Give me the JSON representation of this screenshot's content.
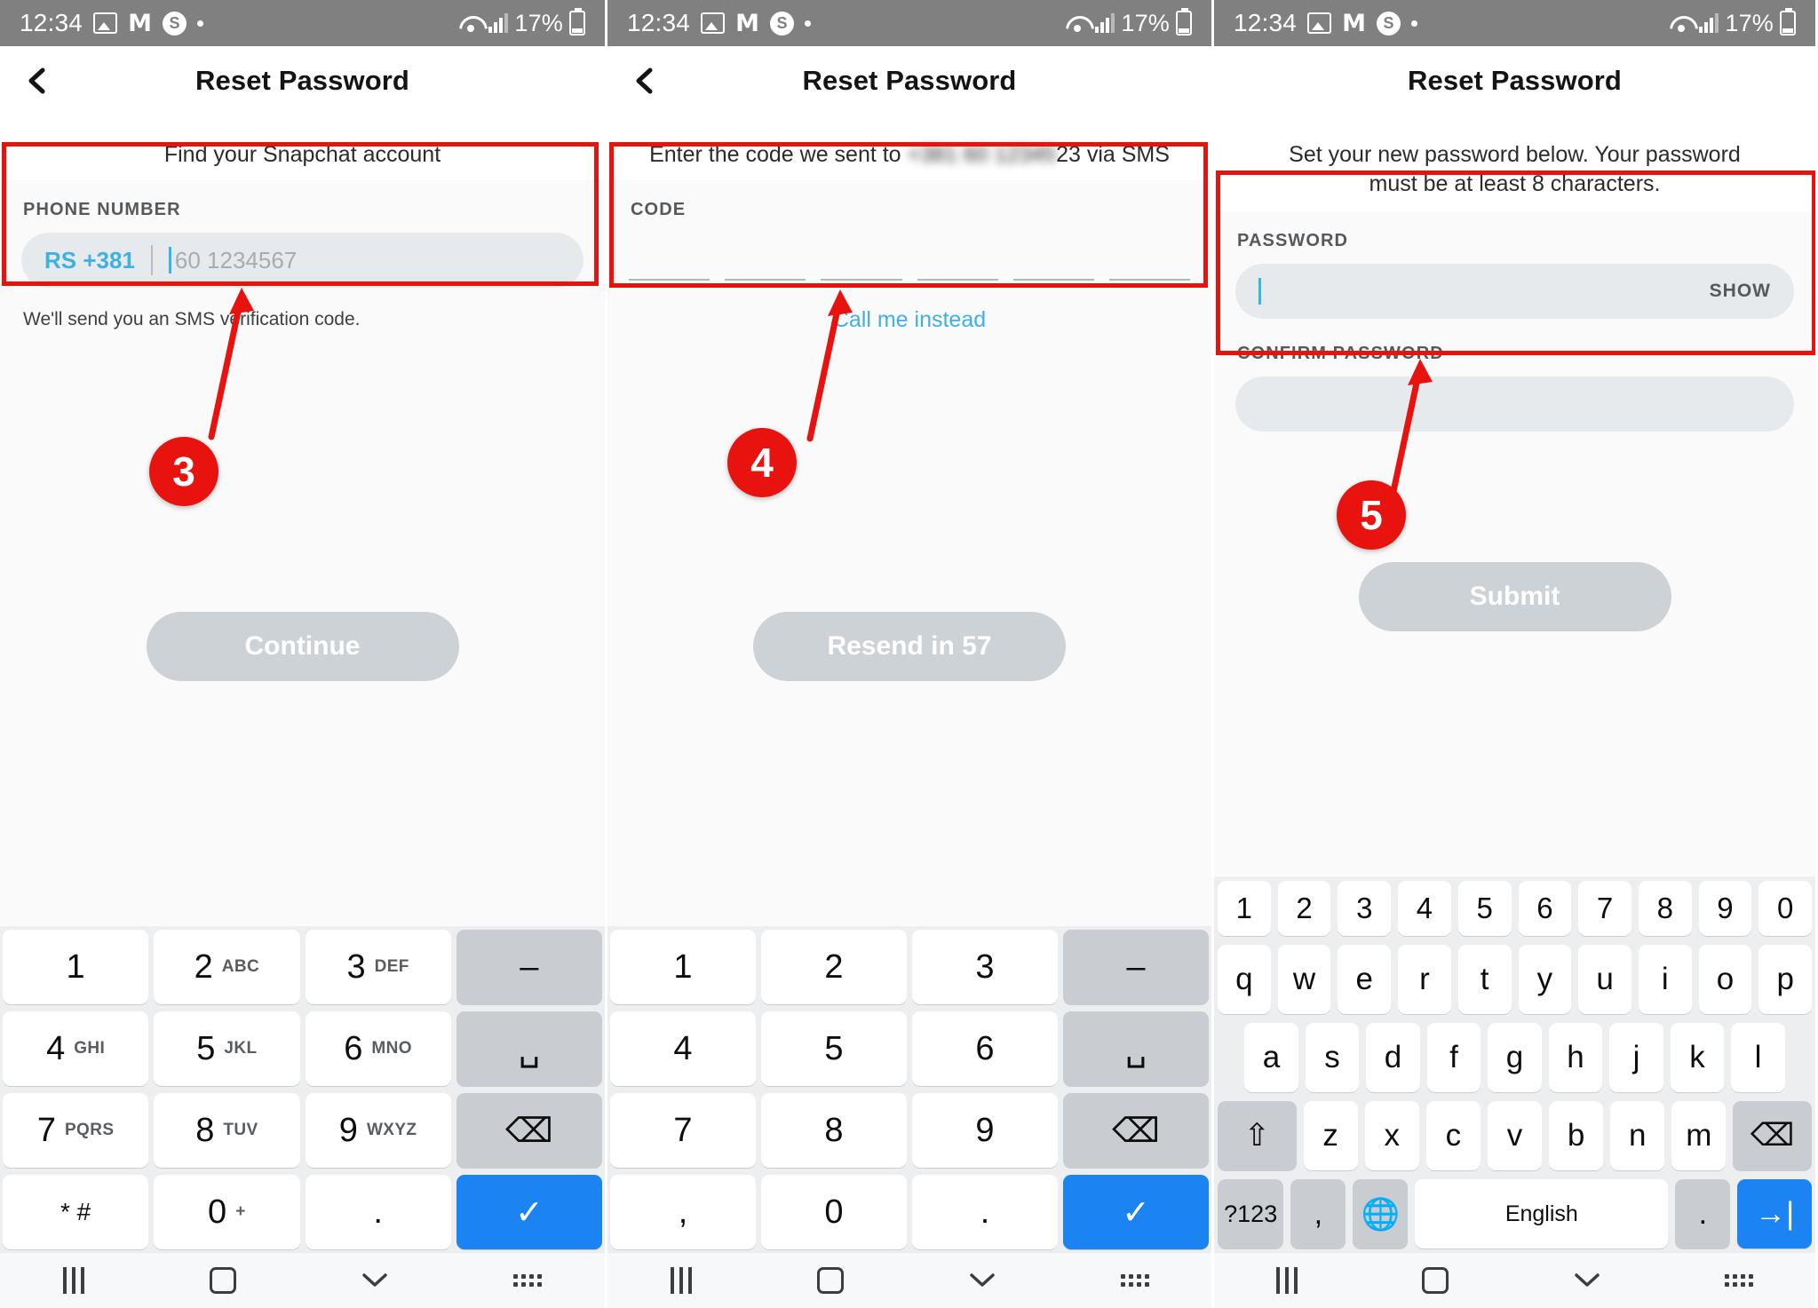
{
  "status_bar": {
    "time": "12:34",
    "battery": "17%",
    "icons": [
      "photos-icon",
      "gmail-icon",
      "skype-icon",
      "dot-icon",
      "wifi-icon",
      "signal-icon",
      "battery-icon"
    ]
  },
  "header": {
    "title": "Reset Password"
  },
  "panel1": {
    "instruction": "Find your Snapchat account",
    "field_label": "PHONE NUMBER",
    "country_code": "RS +381",
    "phone_placeholder": "60 1234567",
    "helper": "We'll send you an SMS verification code.",
    "cta_label": "Continue",
    "step_badge": "3"
  },
  "panel2": {
    "instruction_before": "Enter the code we sent to",
    "instruction_blurred": "+381 60 12345",
    "instruction_after": "23 via SMS",
    "field_label": "CODE",
    "code_segments": 6,
    "call_instead": "Call me instead",
    "cta_label": "Resend in 57",
    "step_badge": "4"
  },
  "panel3": {
    "instruction": "Set your new password below. Your password must be at least 8 characters.",
    "password_label": "PASSWORD",
    "show_label": "SHOW",
    "confirm_label": "CONFIRM PASSWORD",
    "cta_label": "Submit",
    "step_badge": "5"
  },
  "keyboard_numeric": [
    [
      {
        "main": "1",
        "sub": ""
      },
      {
        "main": "2",
        "sub": "ABC"
      },
      {
        "main": "3",
        "sub": "DEF"
      },
      {
        "main": "–",
        "sub": "",
        "style": "gray"
      }
    ],
    [
      {
        "main": "4",
        "sub": "GHI"
      },
      {
        "main": "5",
        "sub": "JKL"
      },
      {
        "main": "6",
        "sub": "MNO"
      },
      {
        "main": "␣",
        "sub": "",
        "style": "gray"
      }
    ],
    [
      {
        "main": "7",
        "sub": "PQRS"
      },
      {
        "main": "8",
        "sub": "TUV"
      },
      {
        "main": "9",
        "sub": "WXYZ"
      },
      {
        "main": "⌫",
        "sub": "",
        "style": "gray"
      }
    ],
    [
      {
        "main": "* #",
        "sub": ""
      },
      {
        "main": "0",
        "sub": "+"
      },
      {
        "main": ".",
        "sub": ""
      },
      {
        "main": "✓",
        "sub": "",
        "style": "blue"
      }
    ]
  ],
  "keyboard_numeric_plain": [
    [
      {
        "main": "1",
        "sub": ""
      },
      {
        "main": "2",
        "sub": ""
      },
      {
        "main": "3",
        "sub": ""
      },
      {
        "main": "–",
        "sub": "",
        "style": "gray"
      }
    ],
    [
      {
        "main": "4",
        "sub": ""
      },
      {
        "main": "5",
        "sub": ""
      },
      {
        "main": "6",
        "sub": ""
      },
      {
        "main": "␣",
        "sub": "",
        "style": "gray"
      }
    ],
    [
      {
        "main": "7",
        "sub": ""
      },
      {
        "main": "8",
        "sub": ""
      },
      {
        "main": "9",
        "sub": ""
      },
      {
        "main": "⌫",
        "sub": "",
        "style": "gray"
      }
    ],
    [
      {
        "main": ",",
        "sub": ""
      },
      {
        "main": "0",
        "sub": ""
      },
      {
        "main": ".",
        "sub": ""
      },
      {
        "main": "✓",
        "sub": "",
        "style": "blue"
      }
    ]
  ],
  "keyboard_alpha": {
    "numbers": [
      "1",
      "2",
      "3",
      "4",
      "5",
      "6",
      "7",
      "8",
      "9",
      "0"
    ],
    "row1": [
      "q",
      "w",
      "e",
      "r",
      "t",
      "y",
      "u",
      "i",
      "o",
      "p"
    ],
    "row2": [
      "a",
      "s",
      "d",
      "f",
      "g",
      "h",
      "j",
      "k",
      "l"
    ],
    "row3": [
      "z",
      "x",
      "c",
      "v",
      "b",
      "n",
      "m"
    ],
    "shift": "⇧",
    "delete": "⌫",
    "symbols": "?123",
    "comma": ",",
    "globe": "🌐",
    "space": "English",
    "period": ".",
    "enter": "→|"
  },
  "nav_bar": {
    "recents": "recents-icon",
    "home": "home-icon",
    "back": "back-chevron-icon",
    "keyboard": "keyboard-icon"
  },
  "colors": {
    "annotation_red": "#e8120e",
    "accent_blue": "#3fb0e0",
    "key_blue": "#1b84f2",
    "field_gray": "#e7eaec",
    "cta_gray": "#cdd2d6"
  }
}
